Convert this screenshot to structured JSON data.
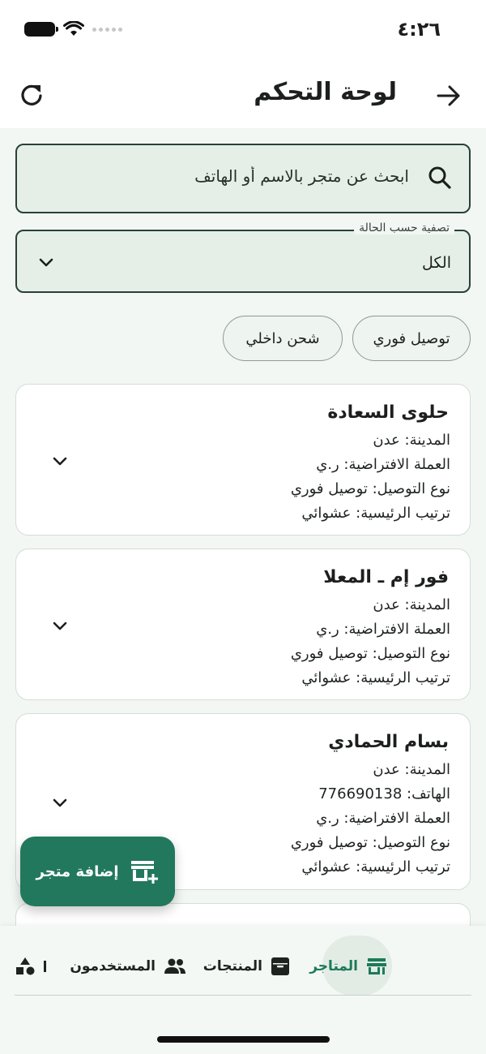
{
  "status": {
    "time": "٤:٢٦"
  },
  "header": {
    "title": "لوحة التحكم"
  },
  "search": {
    "placeholder": "ابحث عن متجر بالاسم أو الهاتف"
  },
  "filter": {
    "label": "تصفية حسب الحالة",
    "value": "الكل"
  },
  "chips": [
    {
      "label": "توصيل فوري"
    },
    {
      "label": "شحن داخلي"
    }
  ],
  "stores": [
    {
      "name": "حلوى السعادة",
      "lines": [
        "المدينة: عدن",
        "العملة الافتراضية: ر.ي",
        "نوع التوصيل: توصيل فوري",
        "ترتيب الرئيسية: عشوائي"
      ]
    },
    {
      "name": "فور إم ـ المعلا",
      "lines": [
        "المدينة: عدن",
        "العملة الافتراضية: ر.ي",
        "نوع التوصيل: توصيل فوري",
        "ترتيب الرئيسية: عشوائي"
      ]
    },
    {
      "name": "بسام الحمادي",
      "lines": [
        "المدينة: عدن",
        "الهاتف: 776690138",
        "العملة الافتراضية: ر.ي",
        "نوع التوصيل: توصيل فوري",
        "ترتيب الرئيسية: عشوائي"
      ]
    }
  ],
  "fab": {
    "label": "إضافة متجر"
  },
  "nav": {
    "stores": "المتاجر",
    "products": "المنتجات",
    "users": "المستخدمون",
    "active": "stores"
  },
  "colors": {
    "primary": "#22785c",
    "active_nav": "#1d7a5a",
    "field_bg": "#e5efe8",
    "page_bg": "#f2f7f3"
  },
  "icons": {
    "back": "arrow-right-icon",
    "refresh": "refresh-icon",
    "search": "search-icon",
    "filter": "chevron-down-icon",
    "card_expand": "chevron-down-icon",
    "fab": "add-store-icon",
    "nav_stores": "store-icon",
    "nav_products": "archive-box-icon",
    "nav_users": "people-icon",
    "nav_more": "shapes-icon"
  }
}
